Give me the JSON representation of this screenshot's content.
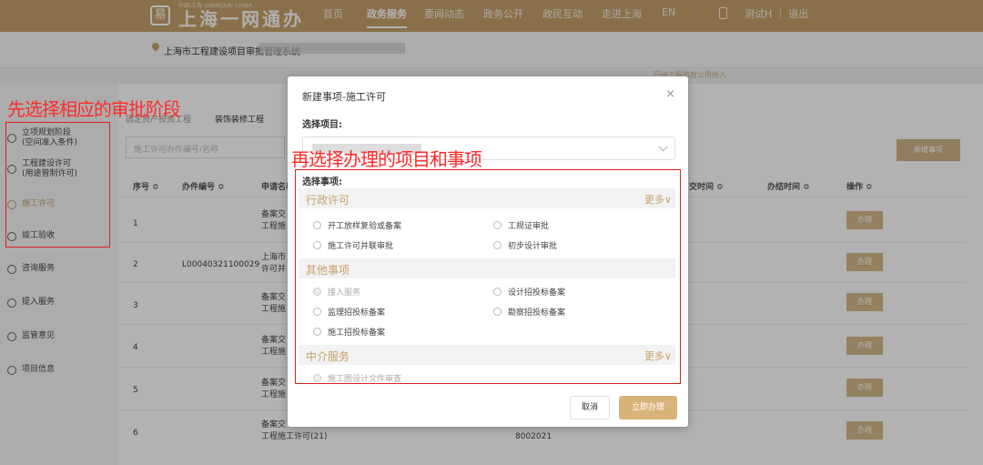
{
  "header": {
    "logo_glyph": "易",
    "logo_mini": "中国·上海 SHANGHAI CHINA",
    "logo_title": "上海一网通办",
    "nav": [
      "首页",
      "政务服务",
      "要闻动态",
      "政务公开",
      "政民互动",
      "走进上海",
      "EN"
    ],
    "active_nav": "政务服务",
    "user_links": "测试H ｜ 退出"
  },
  "location": {
    "text": "上海市工程建设项目审批管理系统",
    "connected": "已接工程市政公用接入"
  },
  "sidebar": {
    "items": [
      {
        "label_1": "立项规划阶段",
        "label_2": "(空间准入条件)",
        "icon": "building-icon"
      },
      {
        "label_1": "工程建设许可",
        "label_2": "(用途管制许可)",
        "icon": "plan-icon"
      },
      {
        "label_1": "施工许可",
        "icon": "construction-icon",
        "active": true
      },
      {
        "label_1": "竣工验收",
        "icon": "acceptance-icon"
      },
      {
        "label_1": "咨询服务",
        "icon": "consult-icon"
      },
      {
        "label_1": "提入服务",
        "icon": "service-icon"
      },
      {
        "label_1": "监管意见",
        "icon": "supervise-icon"
      },
      {
        "label_1": "项目信息",
        "icon": "info-icon"
      }
    ]
  },
  "main": {
    "tabs": [
      "固定资产投资工程",
      "装饰装修工程"
    ],
    "search_placeholder": "施工许可办件编号/名称",
    "add_button": "新增事项",
    "columns": [
      "序号 ≎",
      "办件编号 ≎",
      "申请名称",
      "交时间 ≎",
      "办结时间 ≎",
      "操作 ≎"
    ],
    "rows": [
      {
        "no": "1",
        "code": "",
        "name_1": "备案交",
        "name_2": "工程施"
      },
      {
        "no": "2",
        "code": "L00040321100029",
        "name_1": "上海市",
        "name_2": "许可并"
      },
      {
        "no": "3",
        "code": "",
        "name_1": "备案交",
        "name_2": "工程施"
      },
      {
        "no": "4",
        "code": "",
        "name_1": "备案交",
        "name_2": "工程施"
      },
      {
        "no": "5",
        "code": "",
        "name_1": "备案交",
        "name_2": "工程施"
      },
      {
        "no": "6",
        "code": "",
        "name_1": "备案交",
        "name_2": "工程施工许可(21)",
        "extra": "8002021"
      }
    ],
    "op_label": "办理"
  },
  "annotations": {
    "left": "先选择相应的审批阶段",
    "middle": "再选择办理的项目和事项",
    "color": "#ff2a2a"
  },
  "modal": {
    "title": "新建事项-施工许可",
    "close": "×",
    "project_label": "选择项目:",
    "items_label": "选择事项:",
    "sections": [
      {
        "title": "行政许可",
        "more": "更多∨",
        "options": [
          "开工放样复验或备案",
          "工规证审批",
          "施工许可并联审批",
          "初步设计审批"
        ]
      },
      {
        "title": "其他事项",
        "more": "",
        "options": [
          "接入服务",
          "设计招投标备案",
          "监理招投标备案",
          "勘察招投标备案",
          "施工招投标备案"
        ],
        "disabled": [
          "接入服务"
        ]
      },
      {
        "title": "中介服务",
        "more": "更多∨",
        "options": [
          "施工图设计文件审查"
        ],
        "disabled": [
          "施工图设计文件审查"
        ]
      }
    ],
    "cancel": "取消",
    "confirm": "立即办理"
  },
  "colors": {
    "brand": "#c6a16b",
    "annotation": "#ff2a2a"
  }
}
